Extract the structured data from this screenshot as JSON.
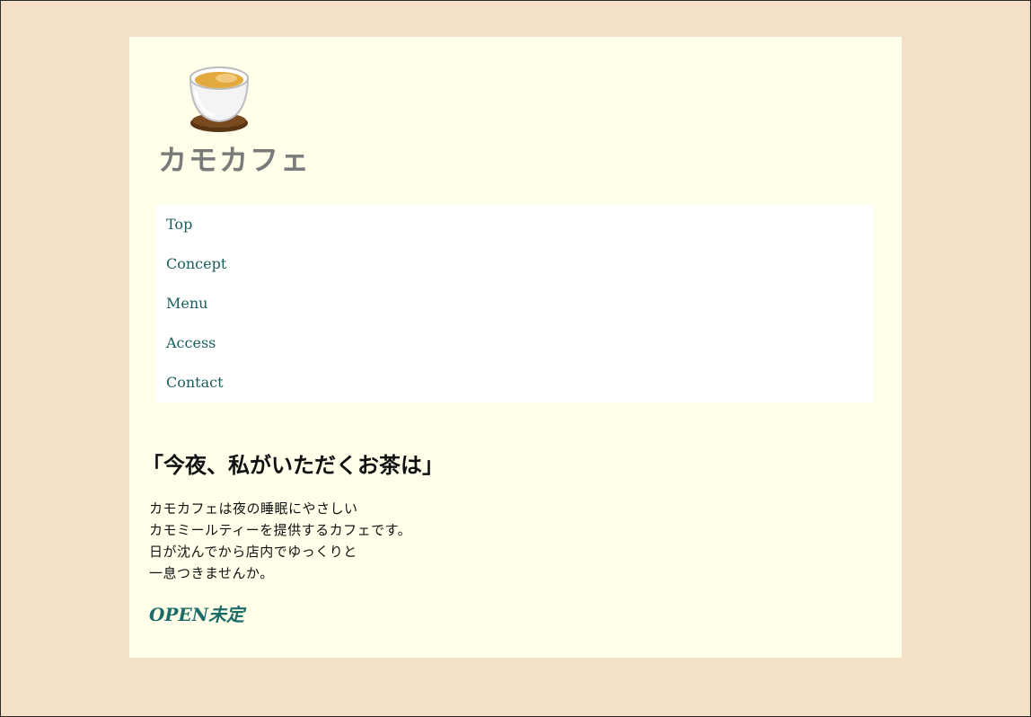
{
  "header": {
    "logo_icon": "teacup-icon",
    "site_title": "カモカフェ"
  },
  "nav": {
    "items": [
      {
        "label": "Top"
      },
      {
        "label": "Concept"
      },
      {
        "label": "Menu"
      },
      {
        "label": "Access"
      },
      {
        "label": "Contact"
      }
    ]
  },
  "main": {
    "headline": "「今夜、私がいただくお茶は」",
    "body_lines": [
      "カモカフェは夜の睡眠にやさしい",
      "カモミールティーを提供するカフェです。",
      "日が沈んでから店内でゆっくりと",
      "一息つきませんか。"
    ],
    "open_status": "OPEN未定"
  },
  "colors": {
    "background": "#f4e0c6",
    "page": "#ffffea",
    "nav_background": "#ffffff",
    "link": "#195e5e",
    "title": "#7a7a7a",
    "accent": "#1b6c68"
  }
}
